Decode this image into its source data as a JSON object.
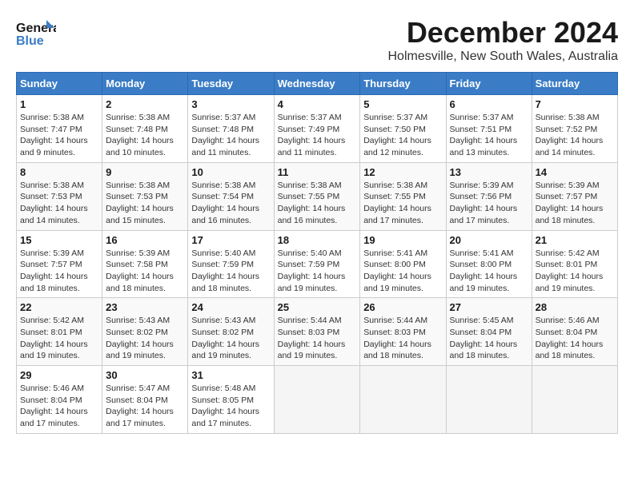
{
  "logo": {
    "text1": "General",
    "text2": "Blue"
  },
  "title": "December 2024",
  "subtitle": "Holmesville, New South Wales, Australia",
  "weekdays": [
    "Sunday",
    "Monday",
    "Tuesday",
    "Wednesday",
    "Thursday",
    "Friday",
    "Saturday"
  ],
  "weeks": [
    [
      {
        "day": "1",
        "info": "Sunrise: 5:38 AM\nSunset: 7:47 PM\nDaylight: 14 hours\nand 9 minutes."
      },
      {
        "day": "2",
        "info": "Sunrise: 5:38 AM\nSunset: 7:48 PM\nDaylight: 14 hours\nand 10 minutes."
      },
      {
        "day": "3",
        "info": "Sunrise: 5:37 AM\nSunset: 7:48 PM\nDaylight: 14 hours\nand 11 minutes."
      },
      {
        "day": "4",
        "info": "Sunrise: 5:37 AM\nSunset: 7:49 PM\nDaylight: 14 hours\nand 11 minutes."
      },
      {
        "day": "5",
        "info": "Sunrise: 5:37 AM\nSunset: 7:50 PM\nDaylight: 14 hours\nand 12 minutes."
      },
      {
        "day": "6",
        "info": "Sunrise: 5:37 AM\nSunset: 7:51 PM\nDaylight: 14 hours\nand 13 minutes."
      },
      {
        "day": "7",
        "info": "Sunrise: 5:38 AM\nSunset: 7:52 PM\nDaylight: 14 hours\nand 14 minutes."
      }
    ],
    [
      {
        "day": "8",
        "info": "Sunrise: 5:38 AM\nSunset: 7:53 PM\nDaylight: 14 hours\nand 14 minutes."
      },
      {
        "day": "9",
        "info": "Sunrise: 5:38 AM\nSunset: 7:53 PM\nDaylight: 14 hours\nand 15 minutes."
      },
      {
        "day": "10",
        "info": "Sunrise: 5:38 AM\nSunset: 7:54 PM\nDaylight: 14 hours\nand 16 minutes."
      },
      {
        "day": "11",
        "info": "Sunrise: 5:38 AM\nSunset: 7:55 PM\nDaylight: 14 hours\nand 16 minutes."
      },
      {
        "day": "12",
        "info": "Sunrise: 5:38 AM\nSunset: 7:55 PM\nDaylight: 14 hours\nand 17 minutes."
      },
      {
        "day": "13",
        "info": "Sunrise: 5:39 AM\nSunset: 7:56 PM\nDaylight: 14 hours\nand 17 minutes."
      },
      {
        "day": "14",
        "info": "Sunrise: 5:39 AM\nSunset: 7:57 PM\nDaylight: 14 hours\nand 18 minutes."
      }
    ],
    [
      {
        "day": "15",
        "info": "Sunrise: 5:39 AM\nSunset: 7:57 PM\nDaylight: 14 hours\nand 18 minutes."
      },
      {
        "day": "16",
        "info": "Sunrise: 5:39 AM\nSunset: 7:58 PM\nDaylight: 14 hours\nand 18 minutes."
      },
      {
        "day": "17",
        "info": "Sunrise: 5:40 AM\nSunset: 7:59 PM\nDaylight: 14 hours\nand 18 minutes."
      },
      {
        "day": "18",
        "info": "Sunrise: 5:40 AM\nSunset: 7:59 PM\nDaylight: 14 hours\nand 19 minutes."
      },
      {
        "day": "19",
        "info": "Sunrise: 5:41 AM\nSunset: 8:00 PM\nDaylight: 14 hours\nand 19 minutes."
      },
      {
        "day": "20",
        "info": "Sunrise: 5:41 AM\nSunset: 8:00 PM\nDaylight: 14 hours\nand 19 minutes."
      },
      {
        "day": "21",
        "info": "Sunrise: 5:42 AM\nSunset: 8:01 PM\nDaylight: 14 hours\nand 19 minutes."
      }
    ],
    [
      {
        "day": "22",
        "info": "Sunrise: 5:42 AM\nSunset: 8:01 PM\nDaylight: 14 hours\nand 19 minutes."
      },
      {
        "day": "23",
        "info": "Sunrise: 5:43 AM\nSunset: 8:02 PM\nDaylight: 14 hours\nand 19 minutes."
      },
      {
        "day": "24",
        "info": "Sunrise: 5:43 AM\nSunset: 8:02 PM\nDaylight: 14 hours\nand 19 minutes."
      },
      {
        "day": "25",
        "info": "Sunrise: 5:44 AM\nSunset: 8:03 PM\nDaylight: 14 hours\nand 19 minutes."
      },
      {
        "day": "26",
        "info": "Sunrise: 5:44 AM\nSunset: 8:03 PM\nDaylight: 14 hours\nand 18 minutes."
      },
      {
        "day": "27",
        "info": "Sunrise: 5:45 AM\nSunset: 8:04 PM\nDaylight: 14 hours\nand 18 minutes."
      },
      {
        "day": "28",
        "info": "Sunrise: 5:46 AM\nSunset: 8:04 PM\nDaylight: 14 hours\nand 18 minutes."
      }
    ],
    [
      {
        "day": "29",
        "info": "Sunrise: 5:46 AM\nSunset: 8:04 PM\nDaylight: 14 hours\nand 17 minutes."
      },
      {
        "day": "30",
        "info": "Sunrise: 5:47 AM\nSunset: 8:04 PM\nDaylight: 14 hours\nand 17 minutes."
      },
      {
        "day": "31",
        "info": "Sunrise: 5:48 AM\nSunset: 8:05 PM\nDaylight: 14 hours\nand 17 minutes."
      },
      null,
      null,
      null,
      null
    ]
  ]
}
